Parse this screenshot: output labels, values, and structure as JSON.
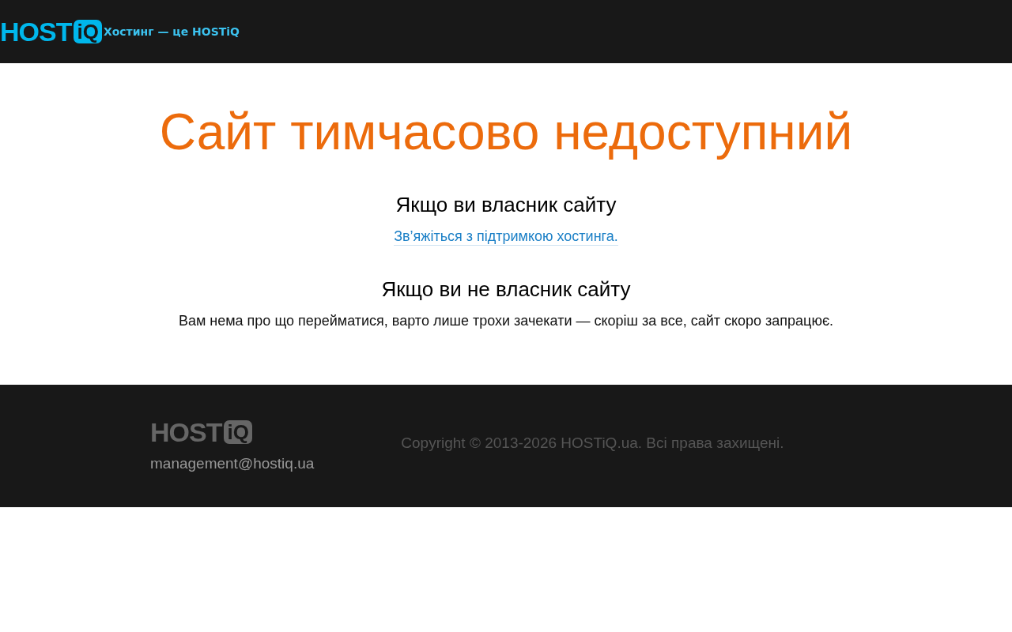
{
  "header": {
    "logo": {
      "word": "HOST",
      "badge": "iQ"
    },
    "tagline": "Хостинг — це HOSTiQ"
  },
  "main": {
    "title": "Сайт тимчасово недоступний",
    "sections": [
      {
        "heading": "Якщо ви власник сайту",
        "kind": "link",
        "text": "Зв’яжіться з підтримкою хостинга."
      },
      {
        "heading": "Якщо ви не власник сайту",
        "kind": "paragraph",
        "text": "Вам нема про що перейматися, варто лише трохи зачекати — скоріш за все, сайт скоро запрацює."
      }
    ]
  },
  "footer": {
    "logo": {
      "word": "HOST",
      "badge": "iQ"
    },
    "email": "management@hostiq.ua",
    "copyright": "Copyright © 2013-2026 HOSTiQ.ua. Всі права захищені."
  }
}
